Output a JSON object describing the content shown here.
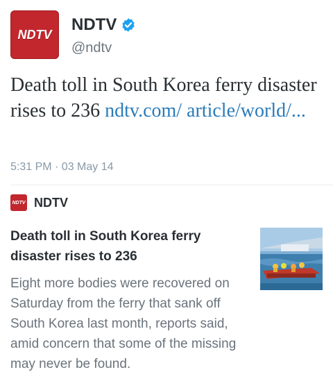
{
  "tweet": {
    "avatar_text": "NDTV",
    "display_name": "NDTV",
    "handle": "@ndtv",
    "text": "Death toll in South Korea ferry disaster rises to 236 ",
    "link": "ndtv.com/ article/world/...",
    "timestamp": "5:31 PM · 03 May 14"
  },
  "card": {
    "logo_text": "NDTV",
    "source": "NDTV",
    "title": "Death toll in South Korea ferry disaster rises to 236",
    "description": "Eight more bodies were recovered on Saturday from the ferry that sank off South Korea last month, reports said, amid concern that some of the missing may never be found."
  },
  "colors": {
    "brand_red": "#c1272d",
    "link_blue": "#2b7bb9",
    "verified_blue": "#1da1f2"
  },
  "icons": {
    "verified": "verified-badge-icon"
  }
}
